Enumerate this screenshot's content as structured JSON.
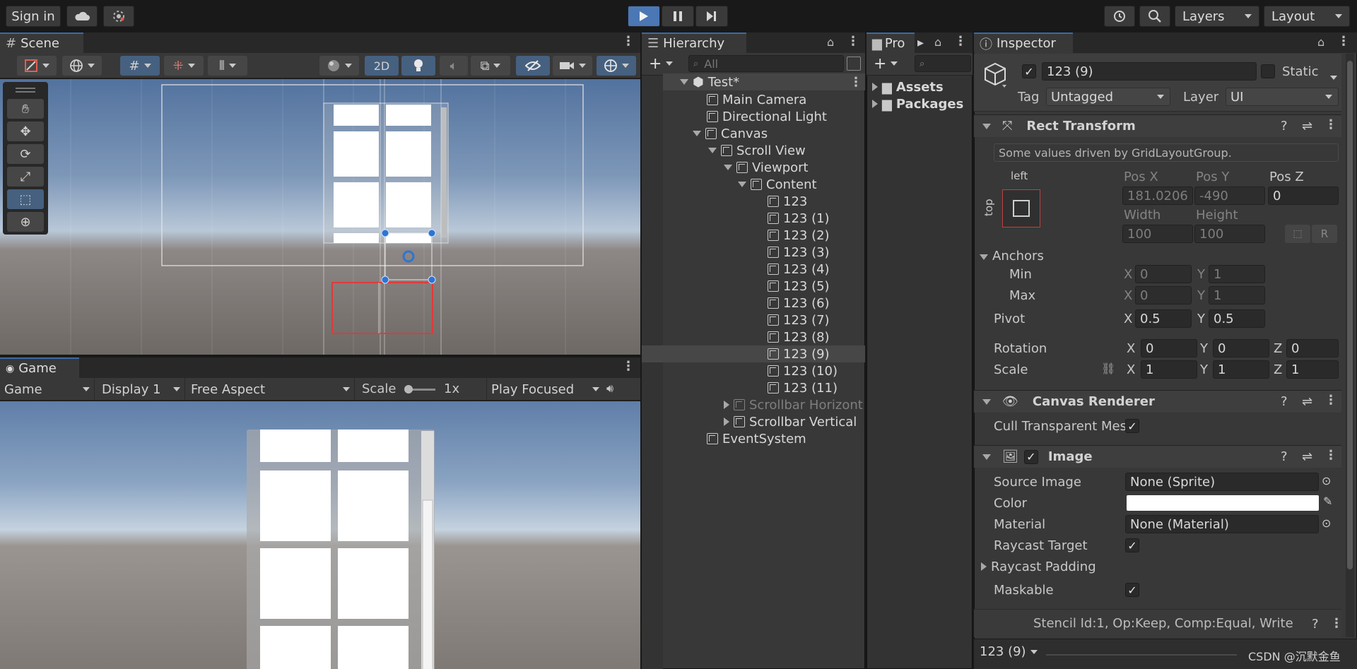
{
  "toolbar": {
    "sign_in": "Sign in",
    "layers": "Layers",
    "layout": "Layout"
  },
  "scene": {
    "tab": "Scene",
    "mode_2d": "2D"
  },
  "game": {
    "tab": "Game",
    "view_select": "Game",
    "display": "Display 1",
    "aspect": "Free Aspect",
    "scale_label": "Scale",
    "scale_value": "1x",
    "play_mode": "Play Focused"
  },
  "hierarchy": {
    "tab": "Hierarchy",
    "search_placeholder": "All",
    "scene_name": "Test*",
    "items": [
      {
        "label": "Main Camera"
      },
      {
        "label": "Directional Light"
      },
      {
        "label": "Canvas"
      },
      {
        "label": "Scroll View"
      },
      {
        "label": "Viewport"
      },
      {
        "label": "Content"
      },
      {
        "label": "123"
      },
      {
        "label": "123 (1)"
      },
      {
        "label": "123 (2)"
      },
      {
        "label": "123 (3)"
      },
      {
        "label": "123 (4)"
      },
      {
        "label": "123 (5)"
      },
      {
        "label": "123 (6)"
      },
      {
        "label": "123 (7)"
      },
      {
        "label": "123 (8)"
      },
      {
        "label": "123 (9)"
      },
      {
        "label": "123 (10)"
      },
      {
        "label": "123 (11)"
      },
      {
        "label": "Scrollbar Horizont"
      },
      {
        "label": "Scrollbar Vertical"
      },
      {
        "label": "EventSystem"
      }
    ]
  },
  "project": {
    "tab": "Pro",
    "folders": [
      "Assets",
      "Packages"
    ]
  },
  "inspector": {
    "tab": "Inspector",
    "object_name": "123 (9)",
    "static_label": "Static",
    "tag_label": "Tag",
    "tag_value": "Untagged",
    "layer_label": "Layer",
    "layer_value": "UI",
    "rect": {
      "title": "Rect Transform",
      "driven_note": "Some values driven by GridLayoutGroup.",
      "anchor_h": "left",
      "anchor_v": "top",
      "posx_label": "Pos X",
      "posx": "181.0206",
      "posy_label": "Pos Y",
      "posy": "-490",
      "posz_label": "Pos Z",
      "posz": "0",
      "width_label": "Width",
      "width": "100",
      "height_label": "Height",
      "height": "100",
      "anchors_label": "Anchors",
      "min_label": "Min",
      "min_x": "0",
      "min_y": "1",
      "max_label": "Max",
      "max_x": "0",
      "max_y": "1",
      "pivot_label": "Pivot",
      "pivot_x": "0.5",
      "pivot_y": "0.5",
      "rotation_label": "Rotation",
      "rot_x": "0",
      "rot_y": "0",
      "rot_z": "0",
      "scale_label": "Scale",
      "scale_x": "1",
      "scale_y": "1",
      "scale_z": "1",
      "x": "X",
      "y": "Y",
      "z": "Z",
      "r": "R"
    },
    "canvas_renderer": {
      "title": "Canvas Renderer",
      "cull_label": "Cull Transparent Mes"
    },
    "image": {
      "title": "Image",
      "source_label": "Source Image",
      "source_value": "None (Sprite)",
      "color_label": "Color",
      "material_label": "Material",
      "material_value": "None (Material)",
      "raycast_label": "Raycast Target",
      "padding_label": "Raycast Padding",
      "maskable_label": "Maskable",
      "stencil": "Stencil Id:1, Op:Keep, Comp:Equal, Write"
    },
    "footer_name": "123 (9)",
    "watermark": "CSDN @沉默金鱼"
  }
}
